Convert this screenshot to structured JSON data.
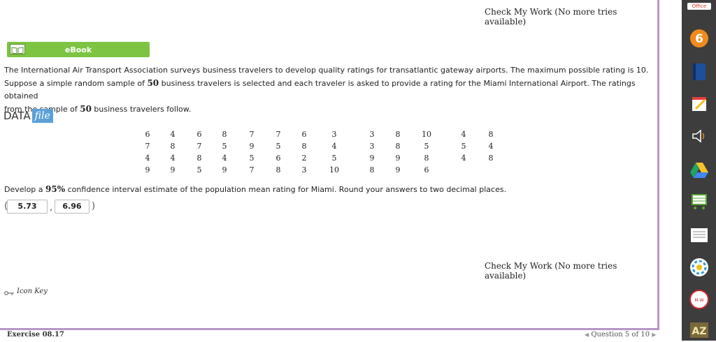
{
  "header": {
    "check_label": "Check My Work (No more tries available)"
  },
  "ebook": {
    "label": "eBook"
  },
  "problem": {
    "line1": "The International Air Transport Association surveys business travelers to develop quality ratings for transatlantic gateway airports. The maximum possible rating is 10.",
    "line2_pre": "Suppose a simple random sample of ",
    "sample_size": "50",
    "line2_post": " business travelers is selected and each traveler is asked to provide a rating for the Miami International Airport. The ratings obtained",
    "line3_pre": "from the sample of ",
    "line3_post": " business travelers follow."
  },
  "data_file": {
    "data_label": "DATA",
    "file_label": "file"
  },
  "ratings": {
    "columns": [
      [
        "6",
        "7",
        "4",
        "9"
      ],
      [
        "4",
        "8",
        "4",
        "9"
      ],
      [
        "6",
        "7",
        "8",
        "5"
      ],
      [
        "8",
        "5",
        "4",
        "9"
      ],
      [
        "7",
        "9",
        "5",
        "7"
      ],
      [
        "7",
        "5",
        "6",
        "8"
      ],
      [
        "6",
        "8",
        "2",
        "3"
      ],
      [
        "3",
        "4",
        "5",
        "10"
      ],
      [
        "3",
        "3",
        "9",
        "8"
      ],
      [
        "8",
        "8",
        "9",
        "9"
      ],
      [
        "10",
        "5",
        "8",
        "6"
      ],
      [
        "4",
        "5",
        "4",
        ""
      ],
      [
        "8",
        "4",
        "8",
        ""
      ]
    ]
  },
  "question": {
    "pre": "Develop a ",
    "confidence": "95%",
    "post": " confidence interval estimate of the population mean rating for Miami. Round your answers to two decimal places."
  },
  "answers": {
    "open_paren": "(",
    "comma": ",",
    "close_paren": ")",
    "lower": "5.73",
    "upper": "6.96"
  },
  "footer": {
    "check_label": "Check My Work (No more tries available)",
    "icon_key": "Icon Key",
    "exercise": "Exercise 08.17",
    "question_nav": "Question 5 of 10"
  },
  "sidebar": {
    "office_label": "Office",
    "icons": [
      "office-icon",
      "badge-six-icon",
      "book-icon",
      "notepad-icon",
      "speaker-icon",
      "drive-icon",
      "cart-icon",
      "list-icon",
      "wheel-icon",
      "merriam-webster-icon",
      "az-icon"
    ]
  },
  "colors": {
    "accent_green": "#7cc442",
    "frame_purple": "#b796c6",
    "data_blue": "#5aa0d7",
    "sidebar_bg": "#3d3d3d"
  }
}
